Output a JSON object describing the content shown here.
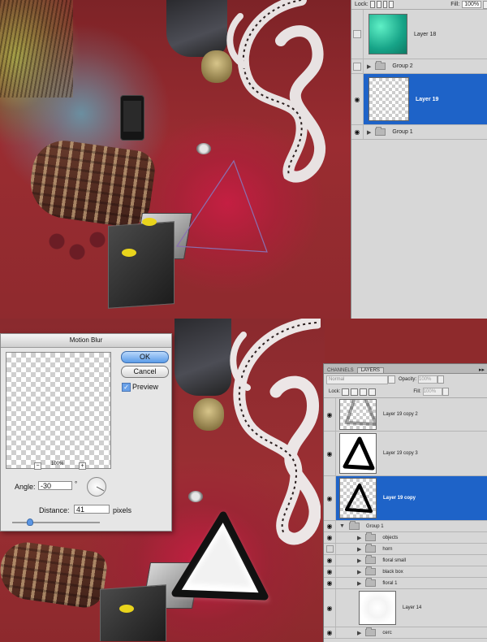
{
  "top_panel": {
    "lock_label": "Lock:",
    "fill_label": "Fill:",
    "fill_value": "100%",
    "layers": [
      {
        "name": "Layer 18",
        "visible": false,
        "type": "layer",
        "selected": false
      },
      {
        "name": "Group 2",
        "visible": false,
        "type": "group",
        "selected": false
      },
      {
        "name": "Layer 19",
        "visible": true,
        "type": "layer",
        "selected": true
      },
      {
        "name": "Group 1",
        "visible": true,
        "type": "group",
        "selected": false
      }
    ]
  },
  "bottom_panel": {
    "tabs": [
      "CHANNELS",
      "LAYERS"
    ],
    "active_tab": "LAYERS",
    "blend_mode": "Normal",
    "opacity_label": "Opacity:",
    "opacity_value": "100%",
    "lock_label": "Lock:",
    "fill_label": "Fill:",
    "fill_value": "100%",
    "layers": [
      {
        "name": "Layer 19 copy 2",
        "type": "layer"
      },
      {
        "name": "Layer 19 copy 3",
        "type": "layer"
      },
      {
        "name": "Layer 19 copy",
        "type": "layer",
        "selected": true
      },
      {
        "name": "Group 1",
        "type": "group",
        "expanded": true
      },
      {
        "name": "objects",
        "type": "group"
      },
      {
        "name": "horn",
        "type": "group"
      },
      {
        "name": "floral small",
        "type": "group"
      },
      {
        "name": "black box",
        "type": "group"
      },
      {
        "name": "floral 1",
        "type": "group"
      },
      {
        "name": "Layer 14",
        "type": "layer"
      },
      {
        "name": "cerc",
        "type": "group"
      }
    ]
  },
  "dialog": {
    "title": "Motion Blur",
    "ok_label": "OK",
    "cancel_label": "Cancel",
    "preview_label": "Preview",
    "preview_checked": true,
    "zoom_value": "100%",
    "zoom_minus": "−",
    "zoom_plus": "+",
    "angle_label": "Angle:",
    "angle_value": "-30",
    "degree_symbol": "°",
    "distance_label": "Distance:",
    "distance_value": "41",
    "pixels_label": "pixels"
  },
  "icons": {
    "eye": "◉",
    "triangle_closed": "▶",
    "triangle_open": "▼",
    "panel_menu": "▸▸"
  },
  "colors": {
    "selection": "#1e63c8",
    "canvas_red": "#9a2c31",
    "triangle_stroke": "#8a6fb0"
  }
}
